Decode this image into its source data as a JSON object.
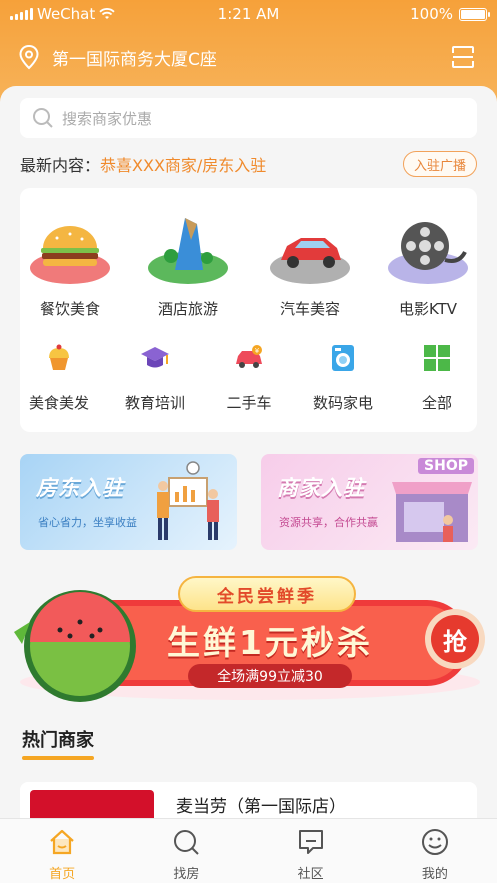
{
  "status_bar": {
    "carrier": "WeChat",
    "time": "1:21 AM",
    "battery": "100%"
  },
  "header": {
    "location": "第一国际商务大厦C座"
  },
  "search": {
    "placeholder": "搜索商家优惠"
  },
  "news": {
    "label": "最新内容：",
    "headline": "恭喜XXX商家/房东入驻",
    "join_button": "入驻广播"
  },
  "categories_main": [
    {
      "label": "餐饮美食",
      "icon": "burger-icon"
    },
    {
      "label": "酒店旅游",
      "icon": "island-icon"
    },
    {
      "label": "汽车美容",
      "icon": "car-icon"
    },
    {
      "label": "电影KTV",
      "icon": "film-reel-icon"
    }
  ],
  "categories_sub": [
    {
      "label": "美食美发",
      "icon": "cake-icon"
    },
    {
      "label": "教育培训",
      "icon": "graduation-cap-icon"
    },
    {
      "label": "二手车",
      "icon": "used-car-icon"
    },
    {
      "label": "数码家电",
      "icon": "washing-machine-icon"
    },
    {
      "label": "全部",
      "icon": "grid-icon"
    }
  ],
  "promos": [
    {
      "title": "房东入驻",
      "subtitle": "省心省力，坐享收益"
    },
    {
      "title": "商家入驻",
      "subtitle": "资源共享，合作共赢",
      "sign": "SHOP"
    }
  ],
  "flash_sale": {
    "tag": "全民尝鲜季",
    "headline": "生鲜1元秒杀",
    "subline": "全场满99立减30",
    "grab_button": "抢"
  },
  "hot": {
    "title": "热门商家"
  },
  "merchants": [
    {
      "name": "麦当劳（第一国际店）"
    }
  ],
  "tabs": [
    {
      "label": "首页",
      "icon": "home-icon",
      "active": true
    },
    {
      "label": "找房",
      "icon": "search-house-icon",
      "active": false
    },
    {
      "label": "社区",
      "icon": "community-icon",
      "active": false
    },
    {
      "label": "我的",
      "icon": "profile-icon",
      "active": false
    }
  ],
  "colors": {
    "accent": "#f5a623",
    "headline": "#f08a2c",
    "flash_red": "#ef3b3b"
  }
}
